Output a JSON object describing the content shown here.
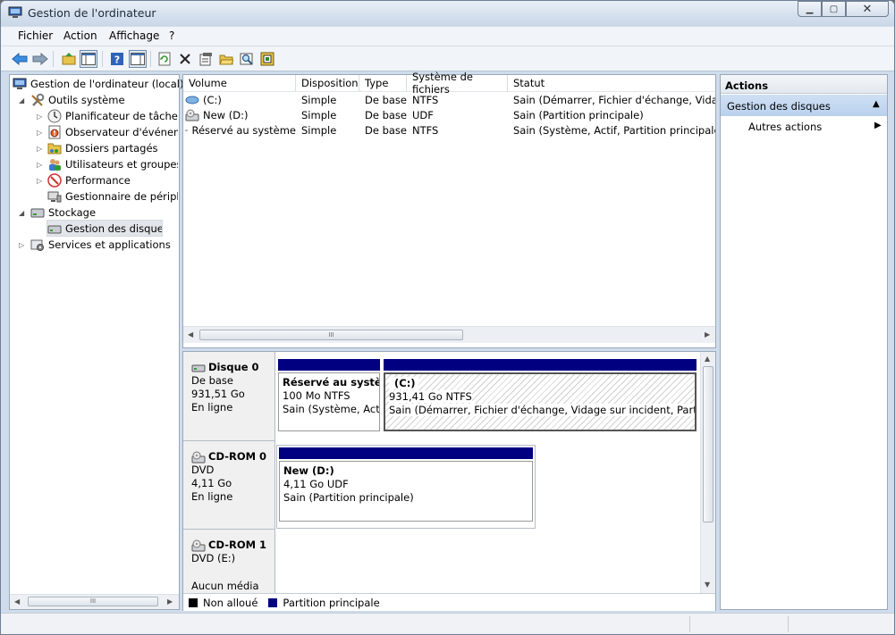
{
  "window": {
    "title": "Gestion de l'ordinateur"
  },
  "menu": [
    "Fichier",
    "Action",
    "Affichage",
    "?"
  ],
  "icons": {
    "toolbar": [
      "back-arrow-icon",
      "forward-arrow-icon",
      "up-folder-icon",
      "console-tree-icon",
      "help-icon",
      "properties-pane-icon",
      "refresh-icon",
      "delete-icon",
      "properties-icon",
      "open-folder-icon",
      "search-icon",
      "format-icon"
    ]
  },
  "tree": [
    {
      "label": "Gestion de l'ordinateur (local)",
      "icon": "computer-management-icon",
      "level": 0
    },
    {
      "label": "Outils système",
      "icon": "tools-icon",
      "level": 1
    },
    {
      "label": "Planificateur de tâches",
      "icon": "clock-icon",
      "level": 2
    },
    {
      "label": "Observateur d'événeme",
      "icon": "event-viewer-icon",
      "level": 2
    },
    {
      "label": "Dossiers partagés",
      "icon": "shared-folder-icon",
      "level": 2
    },
    {
      "label": "Utilisateurs et groupes l",
      "icon": "users-icon",
      "level": 2
    },
    {
      "label": "Performance",
      "icon": "performance-icon",
      "level": 2
    },
    {
      "label": "Gestionnaire de périphé",
      "icon": "device-manager-icon",
      "level": 2
    },
    {
      "label": "Stockage",
      "icon": "storage-icon",
      "level": 1
    },
    {
      "label": "Gestion des disques",
      "icon": "disk-management-icon",
      "level": 2
    },
    {
      "label": "Services et applications",
      "icon": "services-icon",
      "level": 1
    }
  ],
  "volumes": {
    "columns": [
      "Volume",
      "Disposition",
      "Type",
      "Système de fichiers",
      "Statut"
    ],
    "rows": [
      [
        "(C:)",
        "Simple",
        "De base",
        "NTFS",
        "Sain (Démarrer, Fichier d'échange, Vidage s"
      ],
      [
        "New (D:)",
        "Simple",
        "De base",
        "UDF",
        "Sain (Partition principale)"
      ],
      [
        "Réservé au système",
        "Simple",
        "De base",
        "NTFS",
        "Sain (Système, Actif, Partition principale)"
      ]
    ]
  },
  "disks": [
    {
      "name": "Disque 0",
      "type": "De base",
      "size": "931,51 Go",
      "state": "En ligne",
      "partitions": [
        {
          "name": "Réservé au systèm",
          "size": "100 Mo NTFS",
          "status": "Sain (Système, Actif"
        },
        {
          "name": "(C:)",
          "size": "931,41 Go NTFS",
          "status": "Sain (Démarrer, Fichier d'échange, Vidage sur incident, Partition"
        }
      ]
    },
    {
      "name": "CD-ROM 0",
      "type": "DVD",
      "size": "4,11 Go",
      "state": "En ligne",
      "partitions": [
        {
          "name": "New  (D:)",
          "size": "4,11 Go UDF",
          "status": "Sain (Partition principale)"
        }
      ]
    },
    {
      "name": "CD-ROM 1",
      "type": "DVD (E:)",
      "state": "Aucun média"
    }
  ],
  "legend": [
    {
      "label": "Non alloué",
      "color": "#000000"
    },
    {
      "label": "Partition principale",
      "color": "#000080"
    }
  ],
  "actions": {
    "header": "Actions",
    "section": "Gestion des disques",
    "items": [
      "Autres actions"
    ]
  },
  "scroll": {
    "thumb_label": "III"
  }
}
